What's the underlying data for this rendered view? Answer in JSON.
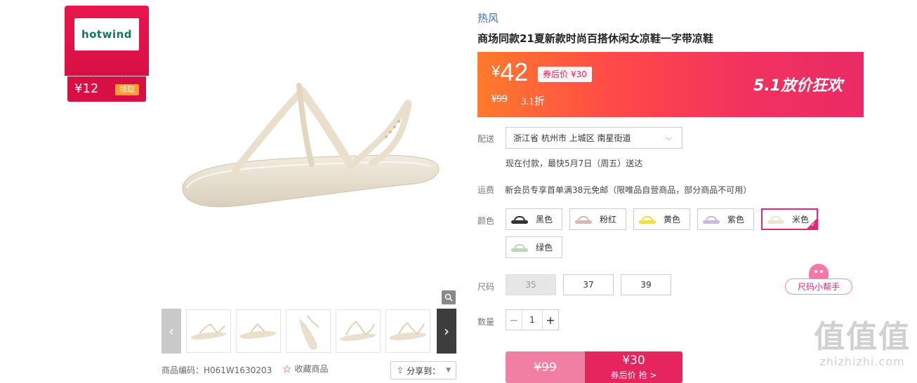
{
  "coupon": {
    "brand_logo": "hotwind",
    "amount": "¥12",
    "claim_label": "领取"
  },
  "gallery": {
    "sku_code": "商品编码：H061W1630203",
    "favorite_label": "收藏商品",
    "share_label": "分享到：",
    "thumbnails_count": 5
  },
  "product": {
    "brand": "热风",
    "title": "商场同款21夏新款时尚百搭休闲女凉鞋一字带凉鞋",
    "price_current": "42",
    "price_currency": "¥",
    "after_coupon": "券后价 ¥30",
    "price_original": "¥99",
    "discount": "3.1折",
    "promo_text": "5.1放价狂欢"
  },
  "delivery": {
    "label": "配送",
    "address": "浙江省 杭州市 上城区 南星街道",
    "note": "现在付款，最快5月7日（周五）送达"
  },
  "shipping": {
    "label": "运费",
    "text": "新会员专享首单满38元免邮（限唯品自营商品，部分商品不可用）"
  },
  "colors": {
    "label": "颜色",
    "options": [
      {
        "name": "黑色",
        "swatch": "#333333",
        "selected": false
      },
      {
        "name": "粉红",
        "swatch": "#d9b8b0",
        "selected": false
      },
      {
        "name": "黄色",
        "swatch": "#f2dc4a",
        "selected": false
      },
      {
        "name": "紫色",
        "swatch": "#c9b8e0",
        "selected": false
      },
      {
        "name": "米色",
        "swatch": "#eee3cf",
        "selected": true
      },
      {
        "name": "绿色",
        "swatch": "#b9d9b6",
        "selected": false
      }
    ]
  },
  "sizes": {
    "label": "尺码",
    "options": [
      {
        "value": "35",
        "disabled": true
      },
      {
        "value": "37",
        "disabled": false
      },
      {
        "value": "39",
        "disabled": false
      }
    ],
    "helper_label": "尺码小帮手"
  },
  "quantity": {
    "label": "数量",
    "value": "1",
    "minus": "−",
    "plus": "+"
  },
  "buy": {
    "old_price": "¥99",
    "new_price": "¥30",
    "sub_label": "券后价 抢 >"
  },
  "watermark": {
    "big": "值值值",
    "small": "zhizhizhi.com"
  },
  "colors_theme": {
    "accent": "#e0287a",
    "banner_start": "#ff7b2c",
    "banner_end": "#ea2b66"
  }
}
